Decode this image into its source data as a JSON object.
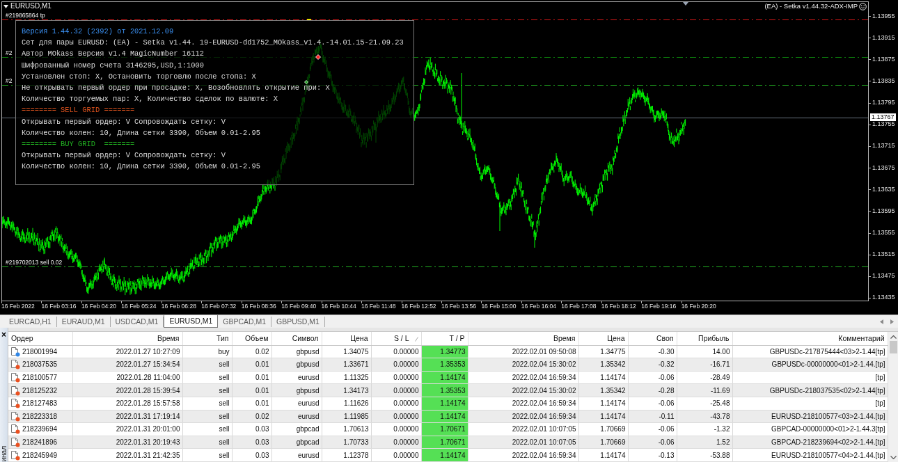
{
  "chart": {
    "symbol": "EURUSD,M1",
    "expert_label": "(EA) - Setka v1.44.32-ADX-IMP",
    "order_lines": [
      {
        "label": "#219865864 tp",
        "color": "#d81818"
      },
      {
        "label": "#2",
        "color": "#0c7c0c"
      },
      {
        "label": "#2",
        "color": "#22b022"
      },
      {
        "label": "#219702013 sell 0.02",
        "color": "#22b022"
      }
    ],
    "current_price": "1.13767",
    "price_ticks": [
      "1.13955",
      "1.13915",
      "1.13875",
      "1.13835",
      "1.13795",
      "1.13755",
      "1.13715",
      "1.13675",
      "1.13635",
      "1.13595",
      "1.13555",
      "1.13515",
      "1.13475",
      "1.13435"
    ],
    "time_ticks": [
      "16 Feb 2022",
      "16 Feb 03:16",
      "16 Feb 04:20",
      "16 Feb 05:24",
      "16 Feb 06:28",
      "16 Feb 07:32",
      "16 Feb 08:36",
      "16 Feb 09:40",
      "16 Feb 10:44",
      "16 Feb 11:48",
      "16 Feb 12:52",
      "16 Feb 13:56",
      "16 Feb 15:00",
      "16 Feb 16:04",
      "16 Feb 17:08",
      "16 Feb 18:12",
      "16 Feb 19:16",
      "16 Feb 20:20"
    ],
    "info_panel": {
      "lines": [
        {
          "text": "Версия 1.44.32 (2392) от 2021.12.09",
          "kind": "version"
        },
        {
          "text": "Сет для пары EURUSD: (EA) - Setka v1.44. 19-EURUSD-dd1752_MOkass_v1.4.-14.01.15-21.09.23",
          "kind": "text"
        },
        {
          "text": "Автор MOkass Версия v1.4 MagicNumber 16112",
          "kind": "text"
        },
        {
          "text": "Шифрованный номер счета 3146295,USD,1:1000",
          "kind": "text"
        },
        {
          "text": "Установлен стоп: X, Остановить торговлю после стопа: X",
          "kind": "text"
        },
        {
          "text": "Не открывать первый ордер при просадке: X, Возобновлять открытие при: X",
          "kind": "text"
        },
        {
          "text": "Количество торгуемых пар: X, Количество сделок по валюте: X",
          "kind": "text"
        },
        {
          "text": "======== SELL GRID =======",
          "kind": "sell"
        },
        {
          "text": "Открывать первый ордер: V Сопровождать сетку: V",
          "kind": "text"
        },
        {
          "text": "Количество колен: 10, Длина сетки 3390, Объем 0.01-2.95",
          "kind": "text"
        },
        {
          "text": "======== BUY GRID  =======",
          "kind": "buy"
        },
        {
          "text": "Открывать первый ордер: V Сопровождать сетку: V",
          "kind": "text"
        },
        {
          "text": "Количество колен: 10, Длина сетки 3390, Объем 0.01-2.95",
          "kind": "text"
        }
      ]
    }
  },
  "tabs": [
    {
      "label": "EURCAD,H1",
      "selected": false
    },
    {
      "label": "EURAUD,M1",
      "selected": false
    },
    {
      "label": "USDCAD,M1",
      "selected": false
    },
    {
      "label": "EURUSD,M1",
      "selected": true
    },
    {
      "label": "GBPCAD,M1",
      "selected": false
    },
    {
      "label": "GBPUSD,M1",
      "selected": false
    }
  ],
  "terminal": {
    "close": "×",
    "side_label": "инал",
    "columns": [
      {
        "label": "Ордер",
        "sorted": false
      },
      {
        "label": "Время",
        "sorted": false
      },
      {
        "label": "Тип",
        "sorted": false
      },
      {
        "label": "Объем",
        "sorted": false
      },
      {
        "label": "Символ",
        "sorted": false
      },
      {
        "label": "Цена",
        "sorted": false
      },
      {
        "label": "S / L",
        "sorted": true
      },
      {
        "label": "T / P",
        "sorted": false
      },
      {
        "label": "Время",
        "sorted": false
      },
      {
        "label": "Цена",
        "sorted": false
      },
      {
        "label": "Своп",
        "sorted": false
      },
      {
        "label": "Прибыль",
        "sorted": false
      },
      {
        "label": "Комментарий",
        "sorted": false
      }
    ],
    "rows": [
      {
        "kind": "buy",
        "cells": [
          "218001994",
          "2022.01.27 10:27:09",
          "buy",
          "0.02",
          "gbpusd",
          "1.34075",
          "0.00000",
          "1.34773",
          "2022.02.01 09:50:08",
          "1.34775",
          "-0.30",
          "14.00",
          "GBPUSDc-217875444<03>2-1.44[tp]"
        ]
      },
      {
        "kind": "sell",
        "cells": [
          "218037535",
          "2022.01.27 15:34:54",
          "sell",
          "0.01",
          "gbpusd",
          "1.33671",
          "0.00000",
          "1.35353",
          "2022.02.04 15:30:02",
          "1.35342",
          "-0.32",
          "-16.71",
          "GBPUSDc-00000000<01>2-1.44.[tp]"
        ]
      },
      {
        "kind": "sell",
        "cells": [
          "218100577",
          "2022.01.28 11:04:00",
          "sell",
          "0.01",
          "eurusd",
          "1.11325",
          "0.00000",
          "1.14174",
          "2022.02.04 16:59:34",
          "1.14174",
          "-0.06",
          "-28.49",
          "[tp]"
        ]
      },
      {
        "kind": "sell",
        "cells": [
          "218125232",
          "2022.01.28 15:39:54",
          "sell",
          "0.01",
          "gbpusd",
          "1.34173",
          "0.00000",
          "1.35353",
          "2022.02.04 15:30:02",
          "1.35342",
          "-0.28",
          "-11.69",
          "GBPUSDc-218037535<02>2-1.44[tp]"
        ]
      },
      {
        "kind": "sell",
        "cells": [
          "218127483",
          "2022.01.28 15:57:58",
          "sell",
          "0.01",
          "eurusd",
          "1.11626",
          "0.00000",
          "1.14174",
          "2022.02.04 16:59:34",
          "1.14174",
          "-0.06",
          "-25.48",
          "[tp]"
        ]
      },
      {
        "kind": "sell",
        "cells": [
          "218223318",
          "2022.01.31 17:19:14",
          "sell",
          "0.02",
          "eurusd",
          "1.11985",
          "0.00000",
          "1.14174",
          "2022.02.04 16:59:34",
          "1.14174",
          "-0.11",
          "-43.78",
          "EURUSD-218100577<03>2-1.44.[tp]"
        ]
      },
      {
        "kind": "sell",
        "cells": [
          "218239694",
          "2022.01.31 20:01:00",
          "sell",
          "0.03",
          "gbpcad",
          "1.70613",
          "0.00000",
          "1.70671",
          "2022.02.01 10:07:05",
          "1.70669",
          "-0.06",
          "-1.32",
          "GBPCAD-00000000<01>2-1.44.3[tp]"
        ]
      },
      {
        "kind": "sell",
        "cells": [
          "218241896",
          "2022.01.31 20:19:43",
          "sell",
          "0.03",
          "gbpcad",
          "1.70733",
          "0.00000",
          "1.70671",
          "2022.02.01 10:07:05",
          "1.70669",
          "-0.06",
          "1.52",
          "GBPCAD-218239694<02>2-1.44.[tp]"
        ]
      },
      {
        "kind": "sell",
        "cells": [
          "218245949",
          "2022.01.31 21:42:35",
          "sell",
          "0.03",
          "eurusd",
          "1.12378",
          "0.00000",
          "1.14174",
          "2022.02.04 16:59:34",
          "1.14174",
          "-0.13",
          "-53.88",
          "EURUSD-218100577<04>2-1.44.[tp]"
        ]
      }
    ]
  }
}
